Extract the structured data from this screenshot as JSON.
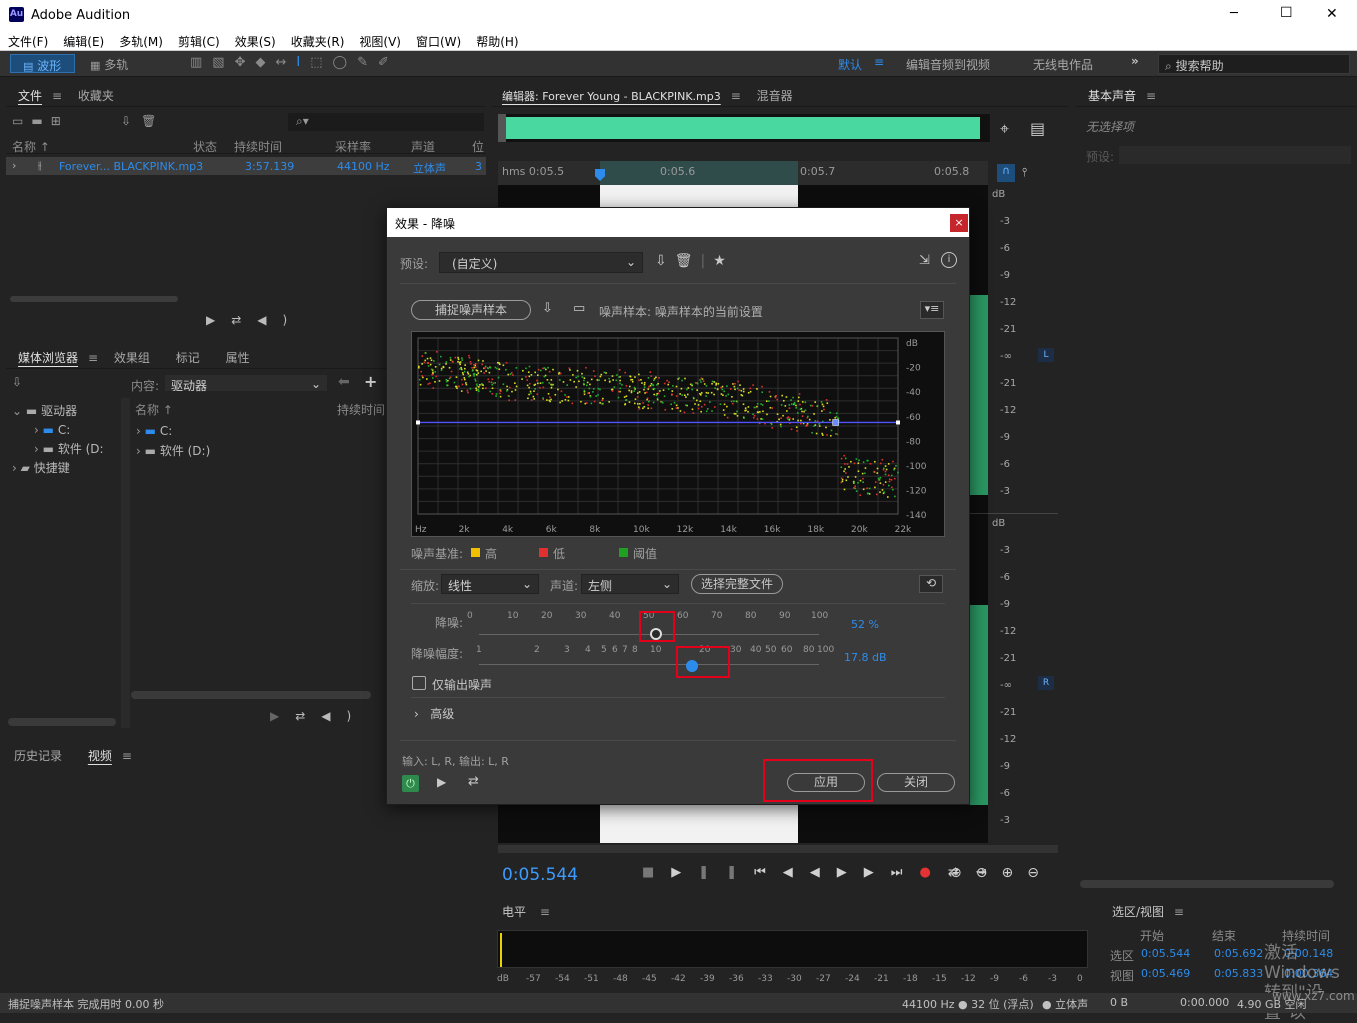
{
  "app": {
    "title": "Adobe Audition",
    "logo": "Au"
  },
  "window_controls": {
    "minimize": "─",
    "maximize": "☐",
    "close": "✕"
  },
  "menu": [
    "文件(F)",
    "编辑(E)",
    "多轨(M)",
    "剪辑(C)",
    "效果(S)",
    "收藏夹(R)",
    "视图(V)",
    "窗口(W)",
    "帮助(H)"
  ],
  "toolbar": {
    "waveform": "波形",
    "multitrack": "多轨",
    "workspaces": [
      "默认",
      "编辑音频到视频",
      "无线电作品"
    ],
    "search_placeholder": "搜索帮助"
  },
  "files_panel": {
    "tabs": [
      "文件",
      "收藏夹"
    ],
    "columns": [
      "名称 ↑",
      "状态",
      "持续时间",
      "采样率",
      "声道",
      "位"
    ],
    "row": {
      "name": "Forever... BLACKPINK.mp3",
      "duration": "3:57.139",
      "rate": "44100 Hz",
      "channels": "立体声",
      "bits": "3"
    }
  },
  "media_panel": {
    "tabs": [
      "媒体浏览器",
      "效果组",
      "标记",
      "属性"
    ],
    "content_label": "内容:",
    "content_value": "驱动器",
    "tree": [
      "驱动器",
      "C:",
      "软件 (D:",
      "快捷键"
    ],
    "list_columns": [
      "名称 ↑",
      "持续时间"
    ],
    "list": [
      "C:",
      "软件 (D:)"
    ]
  },
  "history_panel": {
    "tabs": [
      "历史记录",
      "视频"
    ]
  },
  "editor": {
    "tab": "编辑器: Forever Young - BLACKPINK.mp3",
    "mixer_tab": "混音器",
    "ruler": [
      "hms 0:05.5",
      "0:05.6",
      "0:05.7",
      "0:05.8"
    ],
    "db_top": [
      "dB",
      "-3",
      "-6",
      "-9",
      "-12",
      "-21",
      "-∞",
      "-21",
      "-12",
      "-9",
      "-6",
      "-3"
    ],
    "db_bottom": [
      "dB",
      "-3",
      "-6",
      "-9",
      "-12",
      "-21",
      "-∞",
      "-21",
      "-12",
      "-9",
      "-6",
      "-3"
    ],
    "ch_left": "L",
    "ch_right": "R",
    "time": "0:05.544"
  },
  "level_panel": {
    "title": "电平",
    "scale": [
      "dB",
      "-57",
      "-54",
      "-51",
      "-48",
      "-45",
      "-42",
      "-39",
      "-36",
      "-33",
      "-30",
      "-27",
      "-24",
      "-21",
      "-18",
      "-15",
      "-12",
      "-9",
      "-6",
      "-3",
      "0"
    ]
  },
  "basic_sound": {
    "title": "基本声音",
    "none": "无选择项",
    "preset": "预设:"
  },
  "selection_panel": {
    "title": "选区/视图",
    "cols": [
      "开始",
      "结束",
      "持续时间"
    ],
    "sel_label": "选区",
    "sel": [
      "0:05.544",
      "0:05.692",
      "0:00.148"
    ],
    "view_label": "视图",
    "view": [
      "0:05.469",
      "0:05.833",
      "0:00.364"
    ],
    "watermark": "激活 Windows 转到\"设置\"以"
  },
  "status": {
    "left": "捕捉噪声样本 完成用时 0.00 秒",
    "format": "44100 Hz ● 32 位 (浮点)",
    "channels": "● 立体声",
    "size": "0 B",
    "dur": "0:00.000",
    "free": "4.90 GB 空闲",
    "watermark": "www.xz7.com"
  },
  "dialog": {
    "title": "效果 - 降噪",
    "preset_label": "预设:",
    "preset_value": "(自定义)",
    "capture_btn": "捕捉噪声样本",
    "sample_label": "噪声样本: 噪声样本的当前设置",
    "graph_db": [
      "dB",
      "-20",
      "-40",
      "-60",
      "-80",
      "-100",
      "-120",
      "-140"
    ],
    "graph_hz": [
      "Hz",
      "2k",
      "4k",
      "6k",
      "8k",
      "10k",
      "12k",
      "14k",
      "16k",
      "18k",
      "20k",
      "22k"
    ],
    "legend_label": "噪声基准:",
    "legend": [
      {
        "name": "高",
        "color": "#f0c000"
      },
      {
        "name": "低",
        "color": "#e03030"
      },
      {
        "name": "阈值",
        "color": "#20a020"
      }
    ],
    "scale_label": "缩放:",
    "scale_value": "线性",
    "channel_label": "声道:",
    "channel_value": "左侧",
    "select_file_btn": "选择完整文件",
    "reduce_label": "降噪:",
    "reduce_ticks": [
      "0",
      "10",
      "20",
      "30",
      "40",
      "50",
      "60",
      "70",
      "80",
      "90",
      "100"
    ],
    "reduce_value": "52 %",
    "reduce_level": 0.52,
    "amount_label": "降噪幅度:",
    "amount_ticks": [
      "1",
      "2",
      "3",
      "4",
      "5",
      "6",
      "7",
      "8",
      "10",
      "20",
      "30",
      "40",
      "50",
      "60",
      "80",
      "100"
    ],
    "amount_value": "17.8 dB",
    "amount_level": 17.8,
    "output_noise": "仅输出噪声",
    "advanced": "高级",
    "io": "输入: L, R,  输出: L, R",
    "apply": "应用",
    "close": "关闭"
  }
}
